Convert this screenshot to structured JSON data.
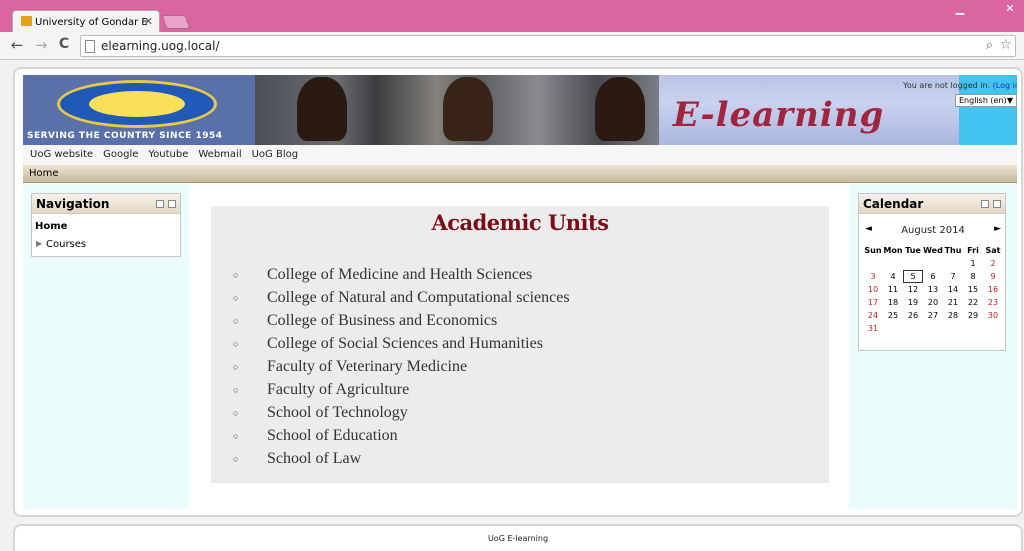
{
  "browser": {
    "tab_title": "University of Gondar E-lea",
    "tab_close": "✕",
    "url": "elearning.uog.local/",
    "back": "←",
    "forward": "→",
    "reload": "C"
  },
  "header": {
    "logo_motto": "SERVING THE COUNTRY SINCE 1954",
    "banner_text": "E-learning",
    "login_status": "You are not logged in.",
    "login_link": "(Log in)",
    "language": "English (en)"
  },
  "custom_menu": [
    "UoG website",
    "Google",
    "Youtube",
    "Webmail",
    "UoG Blog"
  ],
  "navbar": {
    "home": "Home"
  },
  "navigation_block": {
    "title": "Navigation",
    "home": "Home",
    "courses": "Courses"
  },
  "calendar": {
    "title": "Calendar",
    "month": "August 2014",
    "prev": "◄",
    "next": "►",
    "weekdays": [
      "Sun",
      "Mon",
      "Tue",
      "Wed",
      "Thu",
      "Fri",
      "Sat"
    ],
    "weeks": [
      [
        "",
        "",
        "",
        "",
        "",
        "1",
        "2"
      ],
      [
        "3",
        "4",
        "5",
        "6",
        "7",
        "8",
        "9"
      ],
      [
        "10",
        "11",
        "12",
        "13",
        "14",
        "15",
        "16"
      ],
      [
        "17",
        "18",
        "19",
        "20",
        "21",
        "22",
        "23"
      ],
      [
        "24",
        "25",
        "26",
        "27",
        "28",
        "29",
        "30"
      ],
      [
        "31",
        "",
        "",
        "",
        "",
        "",
        ""
      ]
    ],
    "today": "5"
  },
  "main": {
    "title": "Academic Units",
    "units": [
      "College of Medicine and Health Sciences",
      "College of Natural and Computational sciences",
      "College of Business and Economics",
      "College of Social Sciences and Humanities",
      "Faculty of Veterinary Medicine",
      "Faculty of Agriculture",
      "School of Technology",
      "School of Education",
      "School of Law"
    ]
  },
  "footer": {
    "text": "UoG E-learning"
  }
}
